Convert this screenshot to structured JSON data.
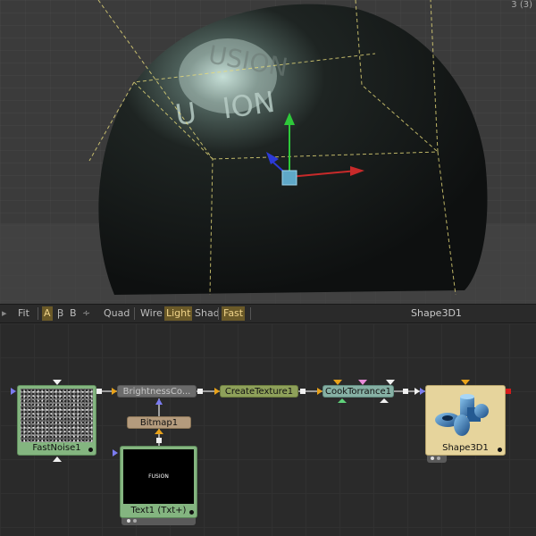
{
  "viewport": {
    "view_label": "3 (3)"
  },
  "toolbar": {
    "items": [
      "Fit",
      "A",
      "B",
      "Quad",
      "Wire",
      "Light",
      "Shad",
      "Fast"
    ],
    "tool_title": "Shape3D1"
  },
  "nodes": {
    "fastnoise": "FastNoise1",
    "brightness": "BrightnessCo...",
    "bitmap": "Bitmap1",
    "text": "Text1 (Txt+)",
    "text_thumb": "FUSION",
    "createtexture": "CreateTexture1",
    "cooktorrance": "CookTorrance1",
    "shape3d": "Shape3D1"
  },
  "colors": {
    "accent_active": "#6b5a28",
    "node_green": "#84b580",
    "node_shape": "#e6d49c",
    "node_cook": "#86b0a4",
    "node_create": "#8ea05a"
  }
}
